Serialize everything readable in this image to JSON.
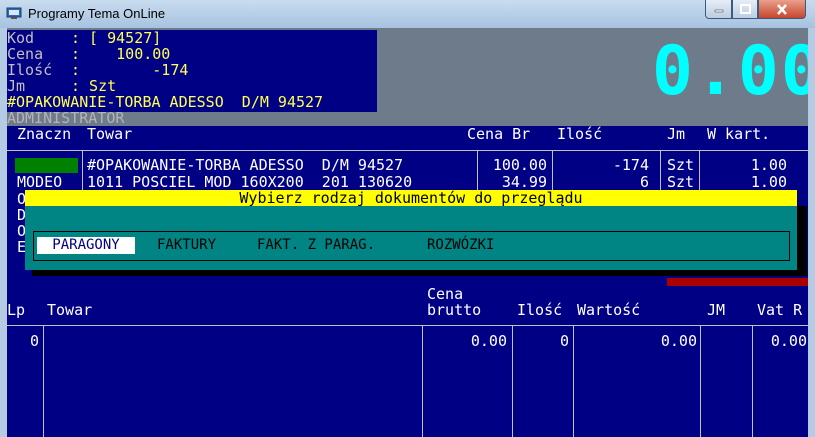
{
  "window": {
    "title": "Programy Tema OnLine"
  },
  "item_info": {
    "kod_label": "Kod",
    "kod_value": ": [ 94527]",
    "cena_label": "Cena",
    "cena_value": ":    100.00",
    "ilosc_label": "Ilość",
    "ilosc_value": ":        -174",
    "jm_label": "Jm",
    "jm_value": ": Szt",
    "name": "#OPAKOWANIE-TORBA ADESSO  D/M 94527"
  },
  "user": "ADMINISTRATOR",
  "total_display": "0.00",
  "upper_table": {
    "headers": {
      "znaczn": "Znaczn",
      "towar": "Towar",
      "cena_br": "Cena Br",
      "ilosc": "Ilość",
      "jm": "Jm",
      "w_kart": "W kart."
    },
    "rows": [
      {
        "znaczn": "",
        "towar": "#OPAKOWANIE-TORBA ADESSO  D/M 94527",
        "cena": "100.00",
        "ilosc": "-174",
        "jm": "Szt",
        "w_kart": "1.00"
      },
      {
        "znaczn": "MODEO",
        "towar": "1011 POSCIEL MOD 160X200  201 130620",
        "cena": "34.99",
        "ilosc": "6",
        "jm": "Szt",
        "w_kart": "1.00"
      }
    ],
    "side_letters": [
      "O",
      "D",
      "O",
      "E"
    ]
  },
  "dialog": {
    "title": "Wybierz rodzaj dokumentów do przeglądu",
    "options": [
      "PARAGONY",
      "FAKTURY",
      "FAKT. Z PARAG.",
      "ROZWÓZKI"
    ],
    "selected": "PARAGONY"
  },
  "lower_table": {
    "headers": {
      "lp": "Lp",
      "towar": "Towar",
      "cena_top": "Cena",
      "cena_bottom": "brutto",
      "ilosc": "Ilość",
      "wartosc": "Wartość",
      "jm": "JM",
      "vat": "Vat R"
    },
    "row": {
      "lp": "0",
      "towar": "",
      "cena": "0.00",
      "ilosc": "0",
      "wartosc": "0.00",
      "jm": "",
      "vat": "0.00"
    }
  },
  "colors": {
    "navy": "#000084",
    "teal": "#008484",
    "yellow": "#ffff00",
    "cyan": "#00ffff",
    "gray_bg": "#6e7b8b"
  }
}
